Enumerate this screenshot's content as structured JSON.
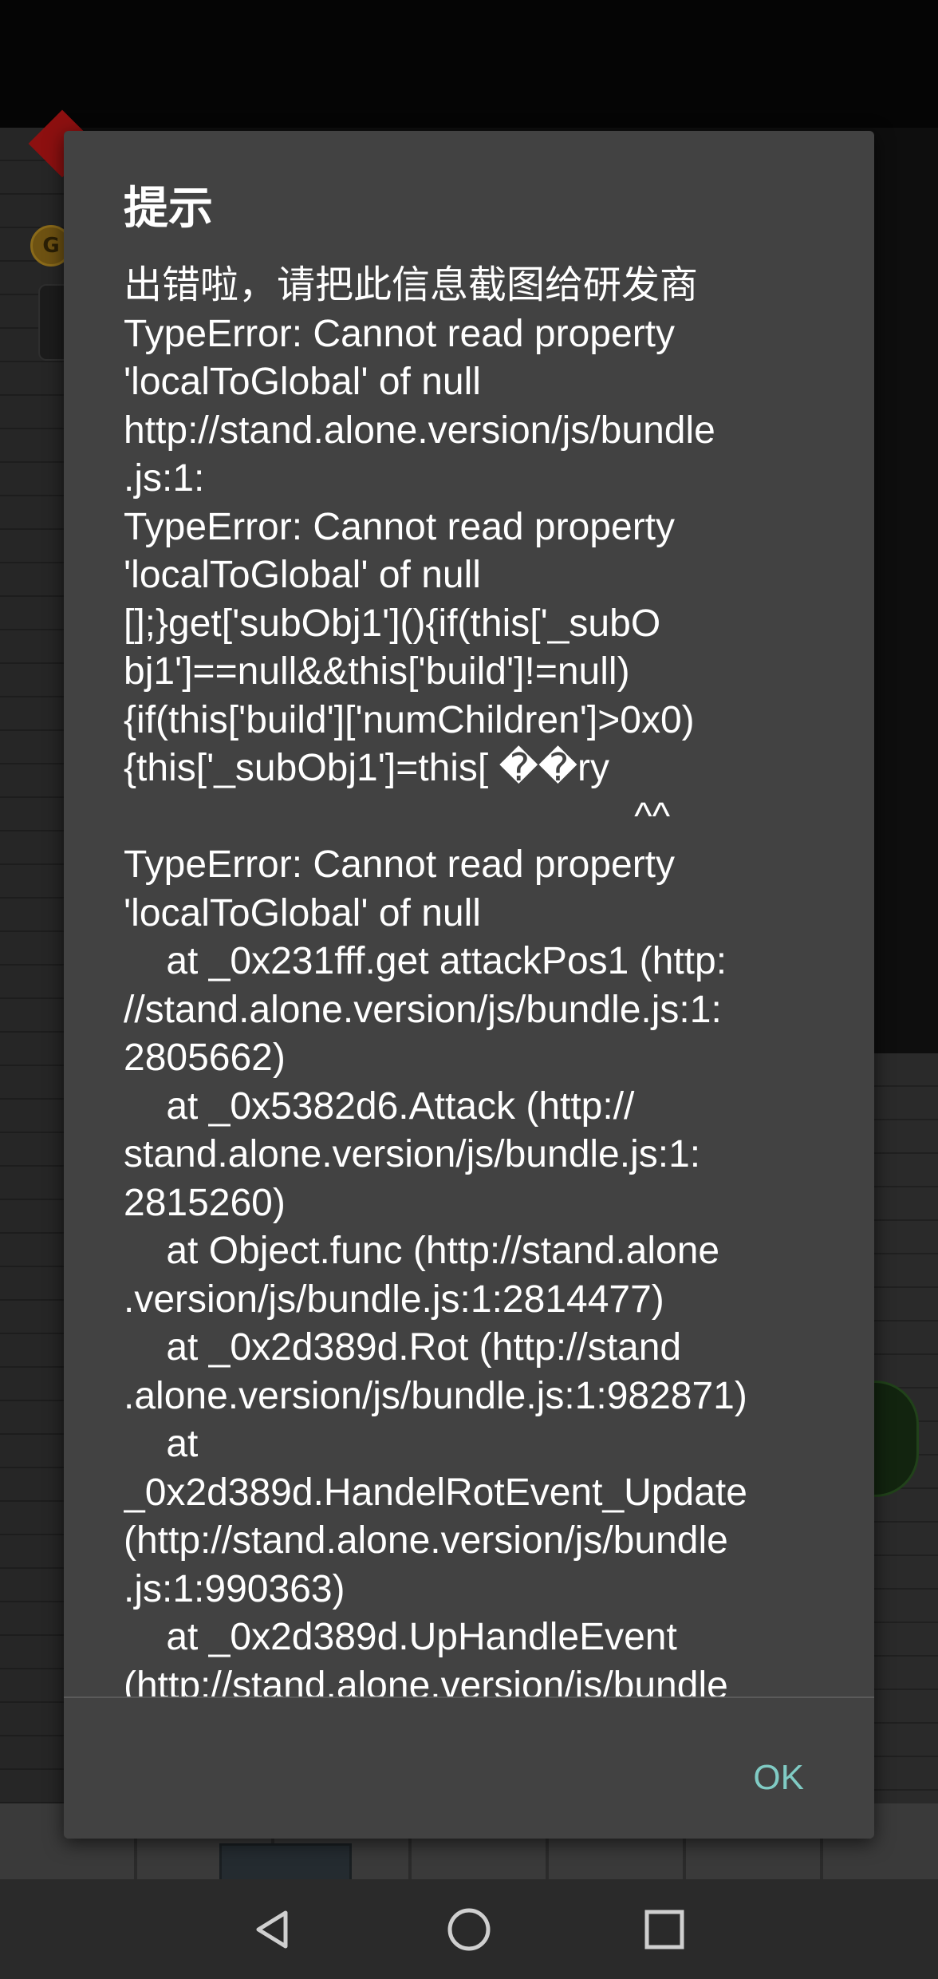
{
  "dialog": {
    "title": "提示",
    "message_lines": [
      "出错啦，请把此信息截图给研发商",
      "TypeError: Cannot read property",
      "'localToGlobal' of null",
      "http://stand.alone.version/js/bundle",
      ".js:1:",
      "TypeError: Cannot read property",
      "'localToGlobal' of null",
      "[];}get['subObj1'](){if(this['_subO",
      "bj1']==null&&this['build']!=null)",
      "{if(this['build']['numChildren']>0x0)",
      "{this['_subObj1']=this[ ��ry",
      "                                                ^^",
      "TypeError: Cannot read property",
      "'localToGlobal' of null",
      "    at _0x231fff.get attackPos1 (http:",
      "//stand.alone.version/js/bundle.js:1:",
      "2805662)",
      "    at _0x5382d6.Attack (http://",
      "stand.alone.version/js/bundle.js:1:",
      "2815260)",
      "    at Object.func (http://stand.alone",
      ".version/js/bundle.js:1:2814477)",
      "    at _0x2d389d.Rot (http://stand",
      ".alone.version/js/bundle.js:1:982871)",
      "    at",
      "_0x2d389d.HandelRotEvent_Update",
      "(http://stand.alone.version/js/bundle",
      ".js:1:990363)",
      "    at _0x2d389d.UpHandleEvent",
      "(http://stand.alone.version/js/bundle"
    ],
    "message": "",
    "ok_label": "OK",
    "ok_color": "#80cbc4",
    "background_color": "#424242"
  },
  "game_background": {
    "coin_letter": "G"
  },
  "nav_bar": {
    "buttons": [
      {
        "icon": "back-triangle-icon"
      },
      {
        "icon": "home-circle-icon"
      },
      {
        "icon": "recents-square-icon"
      }
    ]
  }
}
